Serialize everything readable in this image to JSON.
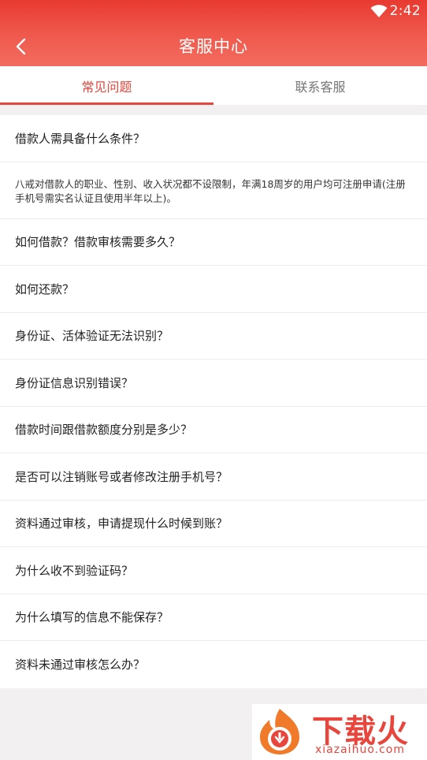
{
  "status_bar": {
    "time": "2:42"
  },
  "header": {
    "title": "客服中心",
    "back_icon": "chevron-left-icon"
  },
  "tabs": [
    {
      "label": "常见问题",
      "active": true
    },
    {
      "label": "联系客服",
      "active": false
    }
  ],
  "faq": {
    "items": [
      {
        "question": "借款人需具备什么条件？",
        "answer": "八戒对借款人的职业、性别、收入状况都不设限制，年满18周岁的用户均可注册申请(注册手机号需实名认证且使用半年以上)。"
      },
      {
        "question": "如何借款？借款审核需要多久？"
      },
      {
        "question": "如何还款？"
      },
      {
        "question": "身份证、活体验证无法识别？"
      },
      {
        "question": "身份证信息识别错误？"
      },
      {
        "question": "借款时间跟借款额度分别是多少？"
      },
      {
        "question": "是否可以注销账号或者修改注册手机号？"
      },
      {
        "question": "资料通过审核，申请提现什么时候到账？"
      },
      {
        "question": "为什么收不到验证码？"
      },
      {
        "question": "为什么填写的信息不能保存？"
      },
      {
        "question": "资料未通过审核怎么办？"
      }
    ]
  },
  "watermark": {
    "name": "下载火",
    "url": "xiazaihuo.com"
  },
  "colors": {
    "accent": "#e8453c",
    "header_top": "#e83a31",
    "background": "#f2f0f0"
  }
}
